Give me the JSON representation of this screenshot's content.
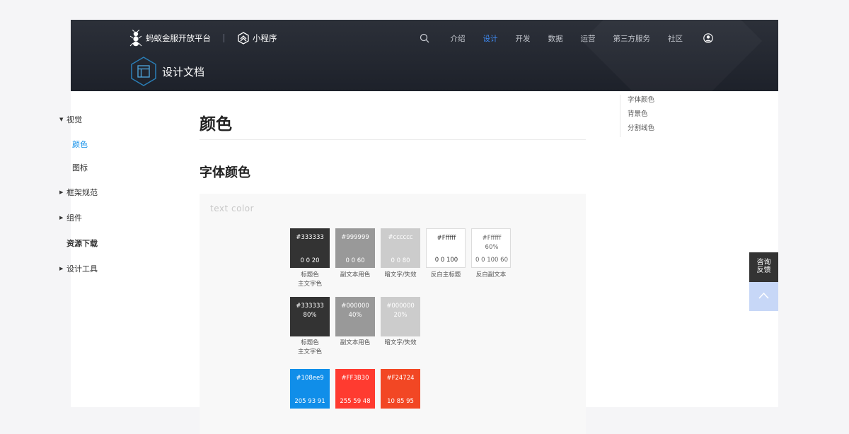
{
  "header": {
    "brand": "蚂蚁金服开放平台",
    "mini_program": "小程序",
    "nav": [
      "介绍",
      "设计",
      "开发",
      "数据",
      "运营",
      "第三方服务",
      "社区"
    ],
    "active_nav": "设计",
    "doc_title": "设计文档"
  },
  "sidebar": {
    "visual": "视觉",
    "color": "颜色",
    "icon": "图标",
    "framework": "框架规范",
    "components": "组件",
    "resources": "资源下载",
    "tools": "设计工具"
  },
  "main": {
    "title": "颜色",
    "section_title": "字体颜色",
    "panel_label": "text color"
  },
  "swatches_row1": [
    {
      "hex": "#333333",
      "rgb": "0 0 20",
      "bg": "#333333",
      "fg": "#ffffff",
      "caption1": "标题色",
      "caption2": "主文字色"
    },
    {
      "hex": "#999999",
      "rgb": "0 0 60",
      "bg": "#999999",
      "fg": "#ffffff",
      "caption1": "副文本用色",
      "caption2": ""
    },
    {
      "hex": "#cccccc",
      "rgb": "0 0 80",
      "bg": "#cccccc",
      "fg": "#ffffff",
      "caption1": "暗文字/失效",
      "caption2": ""
    },
    {
      "hex": "#Ffffff",
      "rgb": "0 0 100",
      "bg": "#ffffff",
      "fg": "#333333",
      "caption1": "反白主标题",
      "caption2": ""
    },
    {
      "hex": "#Ffffff\n60%",
      "rgb": "0 0 100 60",
      "bg": "#ffffff",
      "fg": "#666666",
      "caption1": "反白副文本",
      "caption2": ""
    }
  ],
  "swatches_row2": [
    {
      "hex": "#333333\n80%",
      "rgb": "",
      "bg": "#333333",
      "fg": "#ffffff",
      "caption1": "标题色",
      "caption2": "主文字色"
    },
    {
      "hex": "#000000\n40%",
      "rgb": "",
      "bg": "#999999",
      "fg": "#ffffff",
      "caption1": "副文本用色",
      "caption2": ""
    },
    {
      "hex": "#000000\n20%",
      "rgb": "",
      "bg": "#cccccc",
      "fg": "#ffffff",
      "caption1": "暗文字/失效",
      "caption2": ""
    }
  ],
  "swatches_row3": [
    {
      "hex": "#108ee9",
      "rgb": "205 93 91",
      "bg": "#108ee9",
      "fg": "#ffffff"
    },
    {
      "hex": "#FF3B30",
      "rgb": "255 59 48",
      "bg": "#ff3b30",
      "fg": "#ffffff"
    },
    {
      "hex": "#F24724",
      "rgb": "10 85 95",
      "bg": "#f24724",
      "fg": "#ffffff"
    }
  ],
  "toc": [
    "字体颜色",
    "背景色",
    "分割线色"
  ],
  "float": {
    "consult_line1": "咨询",
    "consult_line2": "反馈"
  }
}
